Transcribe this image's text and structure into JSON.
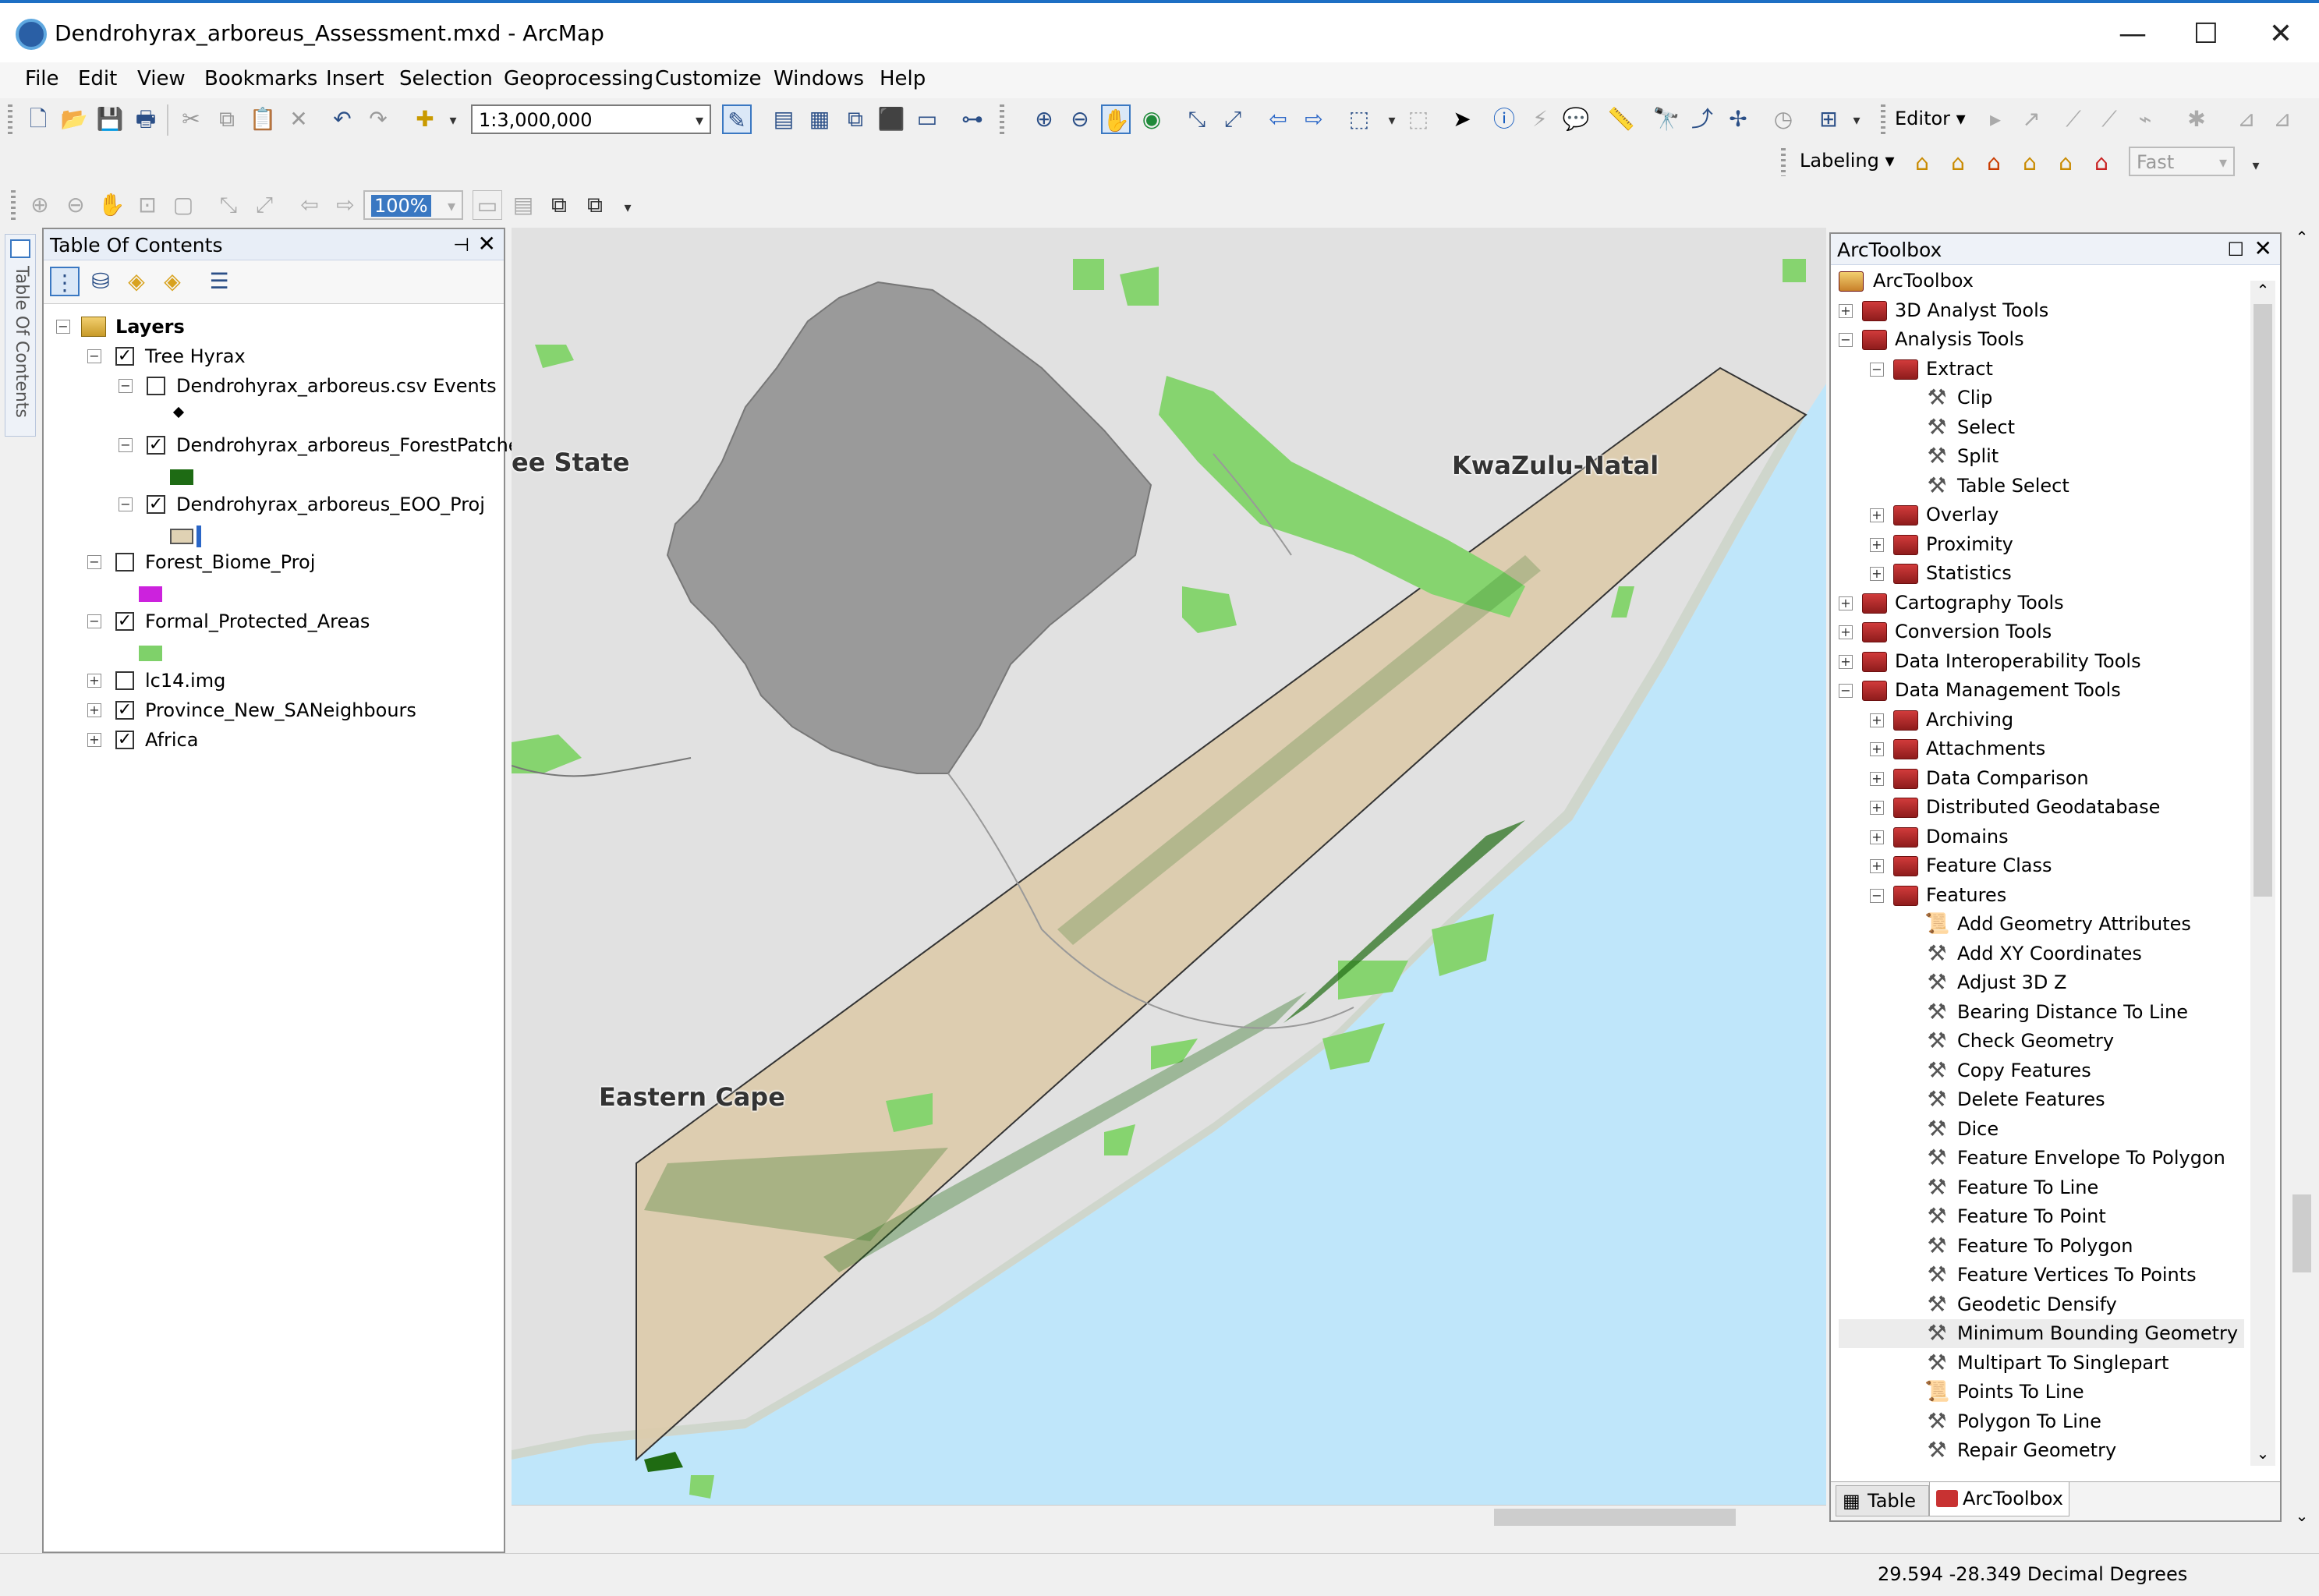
{
  "window": {
    "title": "Dendrohyrax_arboreus_Assessment.mxd - ArcMap",
    "minimize": "—",
    "maximize": "☐",
    "close": "✕"
  },
  "menu": [
    "File",
    "Edit",
    "View",
    "Bookmarks",
    "Insert",
    "Selection",
    "Geoprocessing",
    "Customize",
    "Windows",
    "Help"
  ],
  "toolbar": {
    "scale": "1:3,000,000",
    "editor_label": "Editor",
    "labeling_label": "Labeling",
    "label_quality": "Fast",
    "zoom_percent": "100%"
  },
  "toc": {
    "title": "Table Of Contents",
    "side_tab": "Table Of Contents",
    "layers_root": "Layers",
    "items": [
      {
        "label": "Tree Hyrax",
        "checked": true,
        "expanded": true
      },
      {
        "label": "Dendrohyrax_arboreus.csv Events",
        "checked": false,
        "expanded": true
      },
      {
        "label": "Dendrohyrax_arboreus_ForestPatches",
        "checked": true,
        "expanded": true
      },
      {
        "label": "Dendrohyrax_arboreus_EOO_Proj",
        "checked": true,
        "expanded": true
      },
      {
        "label": "Forest_Biome_Proj",
        "checked": false,
        "expanded": true
      },
      {
        "label": "Formal_Protected_Areas",
        "checked": true,
        "expanded": true
      },
      {
        "label": "lc14.img",
        "checked": false,
        "expanded": false
      },
      {
        "label": "Province_New_SANeighbours",
        "checked": true,
        "expanded": false
      },
      {
        "label": "Africa",
        "checked": true,
        "expanded": false
      }
    ],
    "legend_colors": {
      "forest_patches": "#1e6b14",
      "eoo": "#e0d2b4",
      "forest_biome": "#cc22dd",
      "protected_areas": "#7fd16a"
    }
  },
  "map": {
    "labels": [
      "ee State",
      "KwaZulu-Natal",
      "Eastern Cape"
    ],
    "colors": {
      "land": "#e1e1e1",
      "ocean": "#bfe6fa",
      "lesotho": "#9a9a9a",
      "eoo": "#dccbab",
      "protected": "#86d46f",
      "forest": "#1f6b12"
    }
  },
  "toolbox": {
    "title": "ArcToolbox",
    "root": "ArcToolbox",
    "items": [
      {
        "label": "3D Analyst Tools",
        "kind": "toolbox",
        "level": 0,
        "exp": "+"
      },
      {
        "label": "Analysis Tools",
        "kind": "toolbox",
        "level": 0,
        "exp": "−"
      },
      {
        "label": "Extract",
        "kind": "toolset",
        "level": 1,
        "exp": "−"
      },
      {
        "label": "Clip",
        "kind": "tool",
        "level": 2,
        "exp": ""
      },
      {
        "label": "Select",
        "kind": "tool",
        "level": 2,
        "exp": ""
      },
      {
        "label": "Split",
        "kind": "tool",
        "level": 2,
        "exp": ""
      },
      {
        "label": "Table Select",
        "kind": "tool",
        "level": 2,
        "exp": ""
      },
      {
        "label": "Overlay",
        "kind": "toolset",
        "level": 1,
        "exp": "+"
      },
      {
        "label": "Proximity",
        "kind": "toolset",
        "level": 1,
        "exp": "+"
      },
      {
        "label": "Statistics",
        "kind": "toolset",
        "level": 1,
        "exp": "+"
      },
      {
        "label": "Cartography Tools",
        "kind": "toolbox",
        "level": 0,
        "exp": "+"
      },
      {
        "label": "Conversion Tools",
        "kind": "toolbox",
        "level": 0,
        "exp": "+"
      },
      {
        "label": "Data Interoperability Tools",
        "kind": "toolbox",
        "level": 0,
        "exp": "+"
      },
      {
        "label": "Data Management Tools",
        "kind": "toolbox",
        "level": 0,
        "exp": "−"
      },
      {
        "label": "Archiving",
        "kind": "toolset",
        "level": 1,
        "exp": "+"
      },
      {
        "label": "Attachments",
        "kind": "toolset",
        "level": 1,
        "exp": "+"
      },
      {
        "label": "Data Comparison",
        "kind": "toolset",
        "level": 1,
        "exp": "+"
      },
      {
        "label": "Distributed Geodatabase",
        "kind": "toolset",
        "level": 1,
        "exp": "+"
      },
      {
        "label": "Domains",
        "kind": "toolset",
        "level": 1,
        "exp": "+"
      },
      {
        "label": "Feature Class",
        "kind": "toolset",
        "level": 1,
        "exp": "+"
      },
      {
        "label": "Features",
        "kind": "toolset",
        "level": 1,
        "exp": "−"
      },
      {
        "label": "Add Geometry Attributes",
        "kind": "script",
        "level": 2,
        "exp": ""
      },
      {
        "label": "Add XY Coordinates",
        "kind": "tool",
        "level": 2,
        "exp": ""
      },
      {
        "label": "Adjust 3D Z",
        "kind": "tool",
        "level": 2,
        "exp": ""
      },
      {
        "label": "Bearing Distance To Line",
        "kind": "tool",
        "level": 2,
        "exp": ""
      },
      {
        "label": "Check Geometry",
        "kind": "tool",
        "level": 2,
        "exp": ""
      },
      {
        "label": "Copy Features",
        "kind": "tool",
        "level": 2,
        "exp": ""
      },
      {
        "label": "Delete Features",
        "kind": "tool",
        "level": 2,
        "exp": ""
      },
      {
        "label": "Dice",
        "kind": "tool",
        "level": 2,
        "exp": ""
      },
      {
        "label": "Feature Envelope To Polygon",
        "kind": "tool",
        "level": 2,
        "exp": ""
      },
      {
        "label": "Feature To Line",
        "kind": "tool",
        "level": 2,
        "exp": ""
      },
      {
        "label": "Feature To Point",
        "kind": "tool",
        "level": 2,
        "exp": ""
      },
      {
        "label": "Feature To Polygon",
        "kind": "tool",
        "level": 2,
        "exp": ""
      },
      {
        "label": "Feature Vertices To Points",
        "kind": "tool",
        "level": 2,
        "exp": ""
      },
      {
        "label": "Geodetic Densify",
        "kind": "tool",
        "level": 2,
        "exp": ""
      },
      {
        "label": "Minimum Bounding Geometry",
        "kind": "tool",
        "level": 2,
        "exp": "",
        "highlighted": true
      },
      {
        "label": "Multipart To Singlepart",
        "kind": "tool",
        "level": 2,
        "exp": ""
      },
      {
        "label": "Points To Line",
        "kind": "script",
        "level": 2,
        "exp": ""
      },
      {
        "label": "Polygon To Line",
        "kind": "tool",
        "level": 2,
        "exp": ""
      },
      {
        "label": "Repair Geometry",
        "kind": "tool",
        "level": 2,
        "exp": ""
      }
    ],
    "tabs": [
      "Table",
      "ArcToolbox"
    ]
  },
  "status": {
    "coordinates": "29.594  -28.349 Decimal Degrees"
  }
}
